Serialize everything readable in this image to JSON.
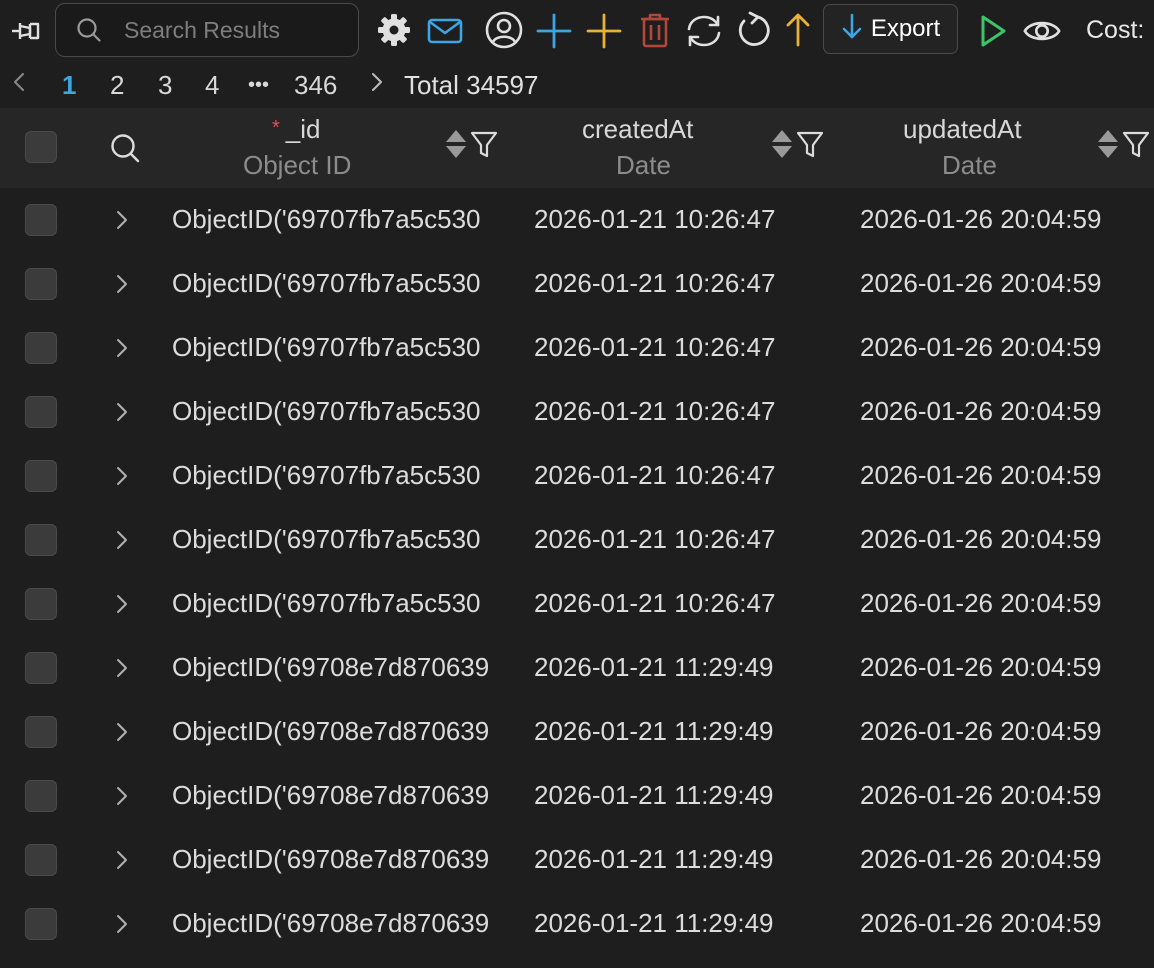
{
  "toolbar": {
    "search_placeholder": "Search Results",
    "export_label": "Export",
    "cost_label": "Cost:",
    "icons": [
      "pin-icon",
      "search-icon",
      "gear-icon",
      "mail-icon",
      "user-circle-icon",
      "plus-icon",
      "plus-icon",
      "trash-icon",
      "sync-icon",
      "refresh-icon",
      "arrow-up-icon",
      "arrow-down-icon",
      "play-icon",
      "eye-icon"
    ],
    "colors": {
      "blue": "#3aa6e4",
      "yellow": "#e8b13a",
      "red": "#b5473a",
      "green": "#3cc46a"
    }
  },
  "pagination": {
    "pages": [
      "1",
      "2",
      "3",
      "4"
    ],
    "ellipsis": "•••",
    "last_page": "346",
    "total": "Total 34597",
    "active_page": "1"
  },
  "table": {
    "columns": [
      {
        "name": "_id",
        "type": "Object ID",
        "required": "*"
      },
      {
        "name": "createdAt",
        "type": "Date"
      },
      {
        "name": "updatedAt",
        "type": "Date"
      }
    ],
    "rows": [
      {
        "id": "ObjectID('69707fb7a5c530",
        "createdAt": "2026-01-21 10:26:47",
        "updatedAt": "2026-01-26 20:04:59"
      },
      {
        "id": "ObjectID('69707fb7a5c530",
        "createdAt": "2026-01-21 10:26:47",
        "updatedAt": "2026-01-26 20:04:59"
      },
      {
        "id": "ObjectID('69707fb7a5c530",
        "createdAt": "2026-01-21 10:26:47",
        "updatedAt": "2026-01-26 20:04:59"
      },
      {
        "id": "ObjectID('69707fb7a5c530",
        "createdAt": "2026-01-21 10:26:47",
        "updatedAt": "2026-01-26 20:04:59"
      },
      {
        "id": "ObjectID('69707fb7a5c530",
        "createdAt": "2026-01-21 10:26:47",
        "updatedAt": "2026-01-26 20:04:59"
      },
      {
        "id": "ObjectID('69707fb7a5c530",
        "createdAt": "2026-01-21 10:26:47",
        "updatedAt": "2026-01-26 20:04:59"
      },
      {
        "id": "ObjectID('69707fb7a5c530",
        "createdAt": "2026-01-21 10:26:47",
        "updatedAt": "2026-01-26 20:04:59"
      },
      {
        "id": "ObjectID('69708e7d870639",
        "createdAt": "2026-01-21 11:29:49",
        "updatedAt": "2026-01-26 20:04:59"
      },
      {
        "id": "ObjectID('69708e7d870639",
        "createdAt": "2026-01-21 11:29:49",
        "updatedAt": "2026-01-26 20:04:59"
      },
      {
        "id": "ObjectID('69708e7d870639",
        "createdAt": "2026-01-21 11:29:49",
        "updatedAt": "2026-01-26 20:04:59"
      },
      {
        "id": "ObjectID('69708e7d870639",
        "createdAt": "2026-01-21 11:29:49",
        "updatedAt": "2026-01-26 20:04:59"
      },
      {
        "id": "ObjectID('69708e7d870639",
        "createdAt": "2026-01-21 11:29:49",
        "updatedAt": "2026-01-26 20:04:59"
      }
    ]
  }
}
